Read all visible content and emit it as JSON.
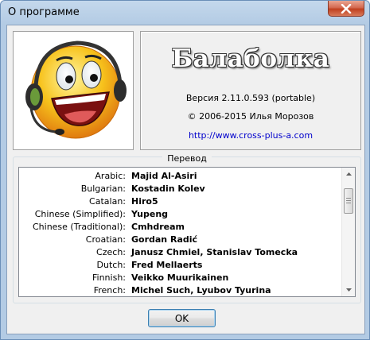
{
  "window": {
    "title": "О программе"
  },
  "app": {
    "name": "Балаболка",
    "version": "Версия 2.11.0.593 (portable)",
    "copyright": "© 2006-2015 Илья Морозов",
    "url": "http://www.cross-plus-a.com"
  },
  "translation": {
    "group_label": "Перевод",
    "rows": [
      {
        "lang": "Arabic:",
        "name": "Majid Al-Asiri"
      },
      {
        "lang": "Bulgarian:",
        "name": "Kostadin Kolev"
      },
      {
        "lang": "Catalan:",
        "name": "Hiro5"
      },
      {
        "lang": "Chinese (Simplified):",
        "name": "Yupeng"
      },
      {
        "lang": "Chinese (Traditional):",
        "name": "Cmhdream"
      },
      {
        "lang": "Croatian:",
        "name": "Gordan Radić"
      },
      {
        "lang": "Czech:",
        "name": "Janusz Chmiel, Stanislav Tomecka"
      },
      {
        "lang": "Dutch:",
        "name": "Fred Mellaerts"
      },
      {
        "lang": "Finnish:",
        "name": "Veikko Muurikainen"
      },
      {
        "lang": "French:",
        "name": "Michel Such, Lyubov Tyurina"
      }
    ]
  },
  "buttons": {
    "ok": "OK"
  },
  "colors": {
    "link": "#0000cc",
    "titlebar": "#b3cbe4",
    "close": "#c0401f"
  }
}
